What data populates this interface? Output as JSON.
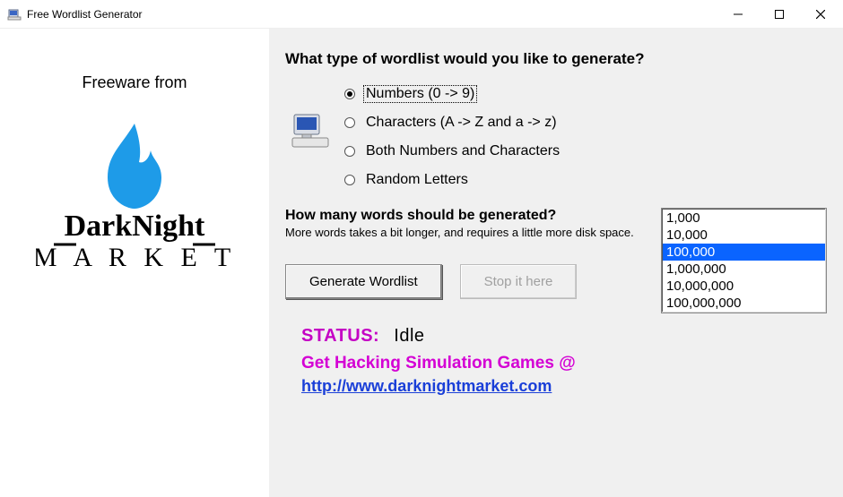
{
  "window": {
    "title": "Free Wordlist Generator"
  },
  "left": {
    "freeware_label": "Freeware from",
    "logo": {
      "top_word": "DarkNight",
      "bottom_word": "M A R K E T"
    }
  },
  "main": {
    "type_question": "What type of wordlist would you like to generate?",
    "radios": [
      {
        "label": "Numbers (0 -> 9)",
        "checked": true,
        "focused": true
      },
      {
        "label": "Characters (A -> Z and a -> z)",
        "checked": false,
        "focused": false
      },
      {
        "label": "Both Numbers and Characters",
        "checked": false,
        "focused": false
      },
      {
        "label": "Random Letters",
        "checked": false,
        "focused": false
      }
    ],
    "count_question": "How many words should be generated?",
    "count_note": "More words takes a bit longer, and requires a little more disk space.",
    "count_options": [
      {
        "label": "1,000",
        "selected": false
      },
      {
        "label": "10,000",
        "selected": false
      },
      {
        "label": "100,000",
        "selected": true
      },
      {
        "label": "1,000,000",
        "selected": false
      },
      {
        "label": "10,000,000",
        "selected": false
      },
      {
        "label": "100,000,000",
        "selected": false
      }
    ],
    "buttons": {
      "generate": "Generate Wordlist",
      "stop": "Stop it here"
    },
    "status": {
      "label": "STATUS:",
      "value": "Idle"
    },
    "promo_text": "Get Hacking Simulation Games @",
    "promo_link": "http://www.darknightmarket.com"
  }
}
